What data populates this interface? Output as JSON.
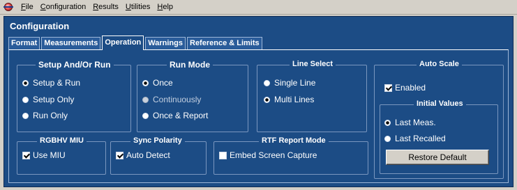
{
  "menu": {
    "app_icon": "application-icon",
    "items": [
      {
        "key": "F",
        "rest": "ile"
      },
      {
        "key": "C",
        "rest": "onfiguration"
      },
      {
        "key": "R",
        "rest": "esults"
      },
      {
        "key": "U",
        "rest": "tilities"
      },
      {
        "key": "H",
        "rest": "elp"
      }
    ]
  },
  "panel": {
    "title": "Configuration",
    "tabs": [
      "Format",
      "Measurements",
      "Operation",
      "Warnings",
      "Reference & Limits"
    ],
    "active_tab": "Operation"
  },
  "setup_and_or_run": {
    "title": "Setup And/Or Run",
    "options": [
      "Setup & Run",
      "Setup Only",
      "Run Only"
    ],
    "selected": "Setup & Run"
  },
  "run_mode": {
    "title": "Run Mode",
    "options": [
      "Once",
      "Continuously",
      "Once & Report"
    ],
    "selected": "Once"
  },
  "line_select": {
    "title": "Line Select",
    "options": [
      "Single Line",
      "Multi Lines"
    ],
    "selected": "Multi Lines"
  },
  "auto_scale": {
    "title": "Auto Scale",
    "enabled_label": "Enabled",
    "enabled": true,
    "initial_values": {
      "title": "Initial Values",
      "options": [
        "Last Meas.",
        "Last Recalled"
      ],
      "selected": "Last Meas."
    },
    "restore_label": "Restore Default"
  },
  "rgbhv_miu": {
    "title": "RGBHV MIU",
    "label": "Use MIU",
    "checked": true
  },
  "sync_polarity": {
    "title": "Sync Polarity",
    "label": "Auto Detect",
    "checked": true
  },
  "rtf_report_mode": {
    "title": "RTF Report Mode",
    "label": "Embed Screen Capture",
    "checked": false
  },
  "colors": {
    "panel_bg": "#1c4c85",
    "window_bg": "#d4d0c8",
    "text": "#ffffff"
  }
}
